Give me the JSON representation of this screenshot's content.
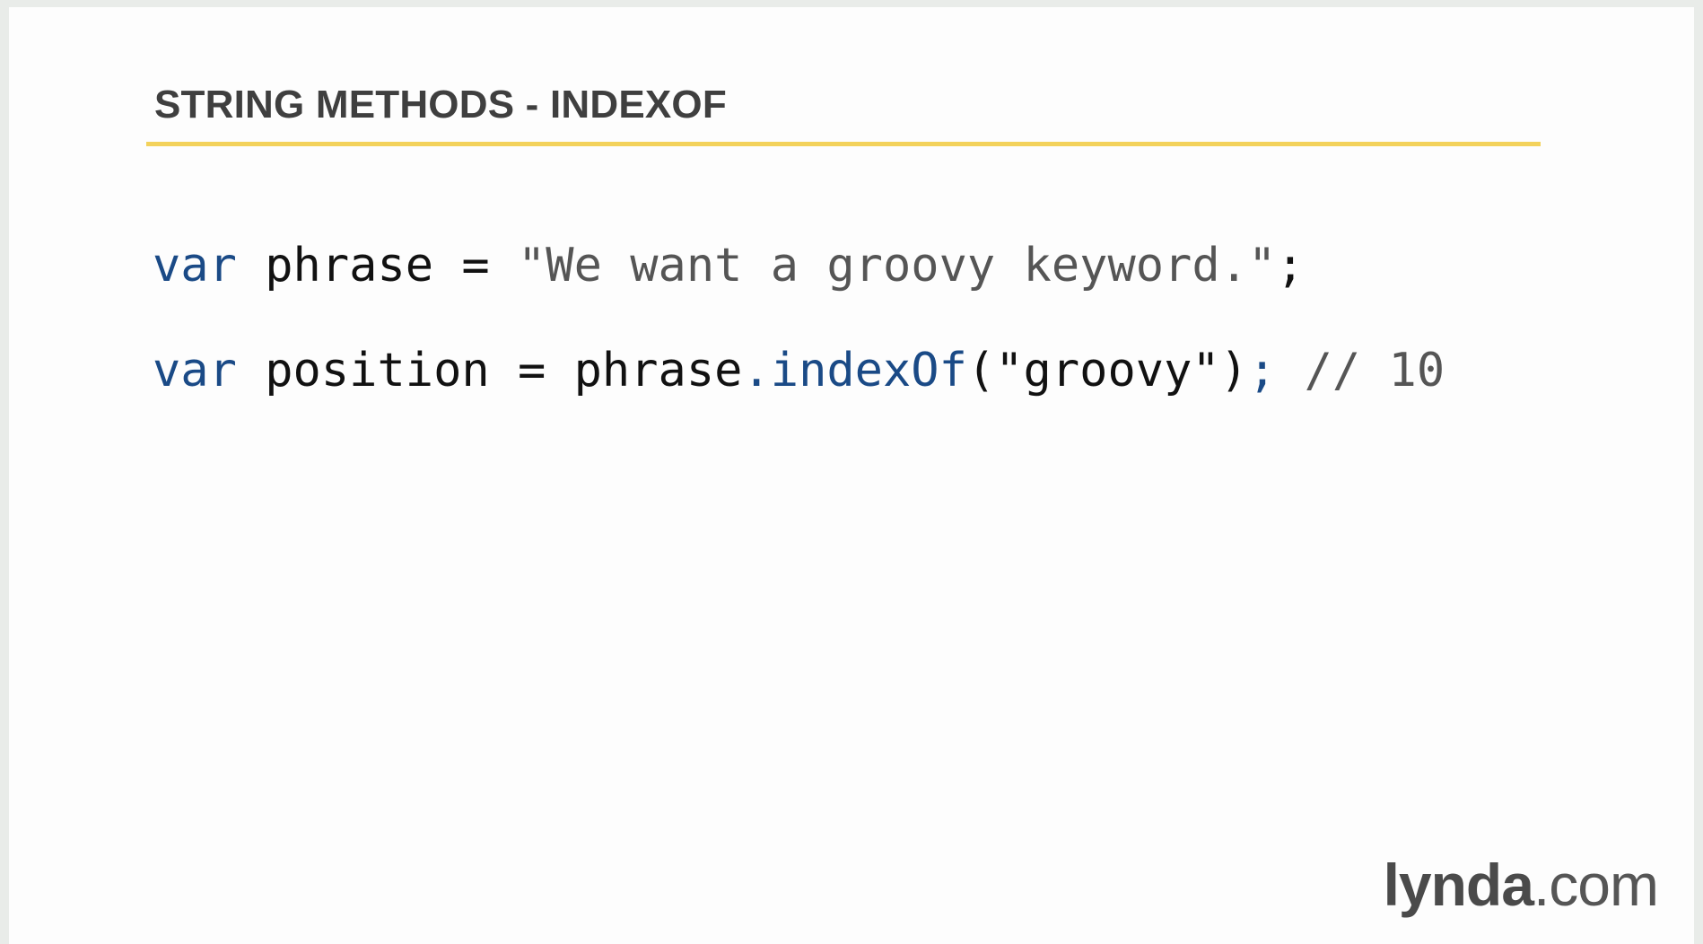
{
  "slide": {
    "title": "STRING METHODS - INDEXOF"
  },
  "code": {
    "line1": {
      "keyword": "var",
      "name": " phrase = ",
      "string": "\"We want a groovy keyword.\"",
      "end": ";"
    },
    "line2": {
      "keyword": "var",
      "name": " position = phrase",
      "dot": ".",
      "method": "indexOf",
      "args": "(\"groovy\")",
      "end": ";",
      "comment": " // 10"
    }
  },
  "logo": {
    "brand": "lynda",
    "suffix": ".com"
  },
  "colors": {
    "accent_rule": "#f3d25b",
    "keyword": "#1a4a86",
    "title": "#3f3f3f"
  }
}
